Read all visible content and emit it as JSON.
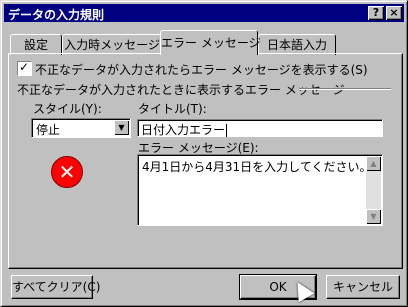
{
  "window": {
    "title": "データの入力規則",
    "help_label": "?",
    "close_label": "×"
  },
  "tabs": [
    {
      "label": "設定"
    },
    {
      "label": "入力時メッセージ"
    },
    {
      "label": "エラー メッセージ"
    },
    {
      "label": "日本語入力"
    }
  ],
  "error_tab": {
    "show_error_checkbox": {
      "label": "不正なデータが入力されたらエラー メッセージを表示する(S)",
      "checked": true
    },
    "group_label": "不正なデータが入力されたときに表示するエラー メッセージ",
    "style_label": "スタイル(Y):",
    "style_value": "停止",
    "style_icon": "stop-error-icon",
    "title_label": "タイトル(T):",
    "title_value": "日付入力エラー",
    "message_label": "エラー メッセージ(E):",
    "message_value": "4月1日から4月31日を入力してください。"
  },
  "buttons": {
    "clear": "すべてクリア(C)",
    "ok": "OK",
    "cancel": "キャンセル"
  },
  "colors": {
    "titlebar": "#000080",
    "face": "#c0c0c0",
    "error_icon": "#ff0000"
  }
}
